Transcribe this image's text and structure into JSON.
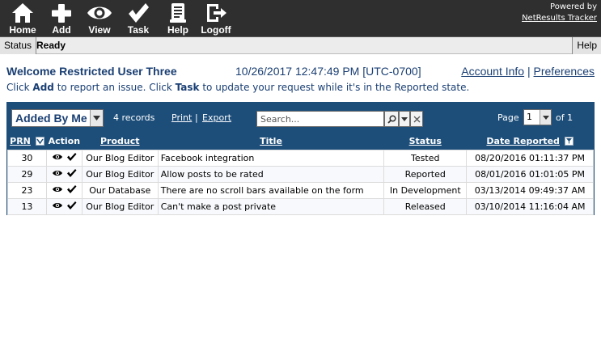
{
  "toolbar": {
    "home_label": "Home",
    "add_label": "Add",
    "view_label": "View",
    "task_label": "Task",
    "help_label": "Help",
    "logoff_label": "Logoff",
    "powered_by": "Powered by",
    "brand": "NetResults Tracker"
  },
  "status_bar": {
    "label": "Status",
    "text": "Ready",
    "help": "Help"
  },
  "header": {
    "welcome": "Welcome Restricted User Three",
    "datetime": "10/26/2017 12:47:49 PM [UTC-0700]",
    "account_info": "Account Info",
    "separator": "|",
    "preferences": "Preferences"
  },
  "instructions": {
    "part1": "Click ",
    "add": "Add",
    "part2": " to report an issue. Click ",
    "task": "Task",
    "part3": " to update your request while it's in the Reported state."
  },
  "report": {
    "view_name": "Added By Me",
    "records": "4 records",
    "print": "Print",
    "export": "Export",
    "link_separator": "|",
    "search_placeholder": "Search...",
    "page_label": "Page",
    "page_value": "1",
    "page_total": "of 1",
    "columns": {
      "prn": "PRN",
      "action": "Action",
      "product": "Product",
      "title": "Title",
      "status": "Status",
      "date": "Date Reported"
    },
    "rows": [
      {
        "prn": "30",
        "product": "Our Blog Editor",
        "title": "Facebook integration",
        "status": "Tested",
        "date": "08/20/2016 01:11:37 PM"
      },
      {
        "prn": "29",
        "product": "Our Blog Editor",
        "title": "Allow posts to be rated",
        "status": "Reported",
        "date": "08/01/2016 01:01:05 PM"
      },
      {
        "prn": "23",
        "product": "Our Database",
        "title": "There are no scroll bars available on the form",
        "status": "In Development",
        "date": "03/13/2014 09:49:37 AM"
      },
      {
        "prn": "13",
        "product": "Our Blog Editor",
        "title": "Can't make a post private",
        "status": "Released",
        "date": "03/10/2014 11:16:04 AM"
      }
    ]
  },
  "colors": {
    "toolbar_bg": "#2f2f2f",
    "panel_bg": "#1d4e7a",
    "text_blue": "#1a3f73"
  }
}
